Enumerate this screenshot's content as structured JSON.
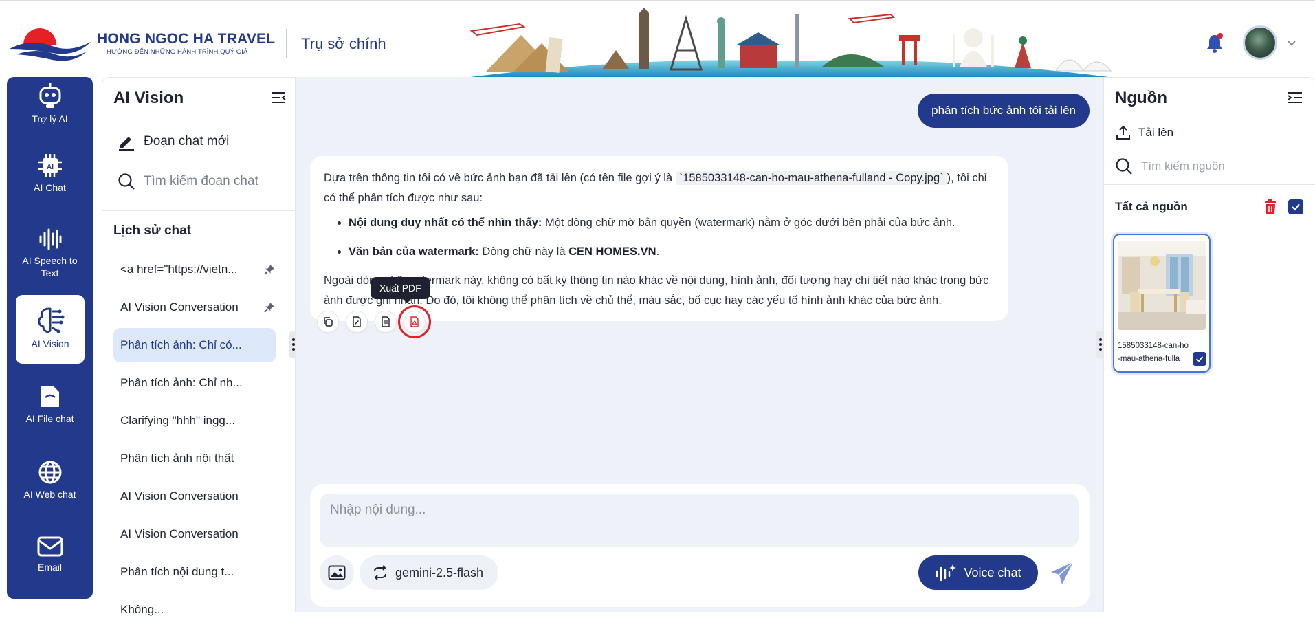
{
  "header": {
    "brand_name": "HONG NGOC HA TRAVEL",
    "brand_tagline": "HƯỚNG ĐẾN NHỮNG HÀNH TRÌNH QUÝ GIÁ",
    "office": "Trụ sở chính"
  },
  "nav": {
    "items": [
      {
        "label": "Trợ lý AI",
        "icon": "robot-icon"
      },
      {
        "label": "AI Chat",
        "icon": "chip-icon"
      },
      {
        "label": "AI Speech to Text",
        "icon": "waveform-icon"
      },
      {
        "label": "AI Vision",
        "icon": "brain-icon",
        "active": true
      },
      {
        "label": "AI File chat",
        "icon": "file-chat-icon"
      },
      {
        "label": "AI Web chat",
        "icon": "globe-icon"
      },
      {
        "label": "Email",
        "icon": "mail-icon"
      }
    ]
  },
  "chat_panel": {
    "title": "AI Vision",
    "new_chat": "Đoạn chat mới",
    "search": "Tìm kiếm đoạn chat",
    "history_title": "Lịch sử chat",
    "history": [
      {
        "label": "<a href=\"https://vietn...",
        "pinned": true
      },
      {
        "label": "AI Vision Conversation",
        "pinned": true
      },
      {
        "label": "Phân tích ảnh: Chỉ có...",
        "active": true
      },
      {
        "label": "Phân tích ảnh: Chỉ nh..."
      },
      {
        "label": "Clarifying \"hhh\" ingg..."
      },
      {
        "label": "Phân tích ảnh nội thất"
      },
      {
        "label": "AI Vision Conversation"
      },
      {
        "label": "AI Vision Conversation"
      },
      {
        "label": "Phân tích nội dung t..."
      },
      {
        "label": "Không..."
      }
    ]
  },
  "conversation": {
    "user_message": "phân tích bức ảnh tôi tải lên",
    "bot": {
      "intro_1": "Dựa trên thông tin tôi có về bức ảnh bạn đã tải lên (có tên file gợi ý là ",
      "filename": "`1585033148-can-ho-mau-athena-fulland - Copy.jpg`",
      "intro_2": "), tôi chỉ có thể phân tích được như sau:",
      "bullet1_bold": "Nội dung duy nhất có thể nhìn thấy:",
      "bullet1_text": " Một dòng chữ mờ bản quyền (watermark) nằm ở góc dưới bên phải của bức ảnh.",
      "bullet2_bold": "Văn bản của watermark:",
      "bullet2_text": " Dòng chữ này là ",
      "bullet2_value": "CEN HOMES.VN",
      "bullet2_end": ".",
      "conclusion": "Ngoài dòng chữ watermark này, không có bất kỳ thông tin nào khác về nội dung, hình ảnh, đối tượng hay chi tiết nào khác trong bức ảnh được ghi nhận. Do đó, tôi không thể phân tích về chủ thể, màu sắc, bố cục hay các yếu tố hình ảnh khác của bức ảnh."
    },
    "actions": [
      {
        "name": "copy",
        "icon": "copy-icon"
      },
      {
        "name": "export-edit",
        "icon": "edit-doc-icon"
      },
      {
        "name": "export-doc",
        "icon": "document-icon"
      },
      {
        "name": "export-pdf",
        "icon": "pdf-icon"
      }
    ],
    "tooltip": "Xuất PDF"
  },
  "composer": {
    "placeholder": "Nhập nội dung...",
    "model": "gemini-2.5-flash",
    "voice_label": "Voice chat"
  },
  "sources": {
    "title": "Nguồn",
    "upload": "Tải lên",
    "search_placeholder": "Tìm kiếm nguồn",
    "all_label": "Tất cả nguồn",
    "file_name": "1585033148-can-ho-mau-athena-fulla"
  },
  "colors": {
    "primary": "#233a8c",
    "accent_red": "#e0222a",
    "panel_bg": "#eef1f7",
    "active_item_bg": "#dde8fb"
  }
}
